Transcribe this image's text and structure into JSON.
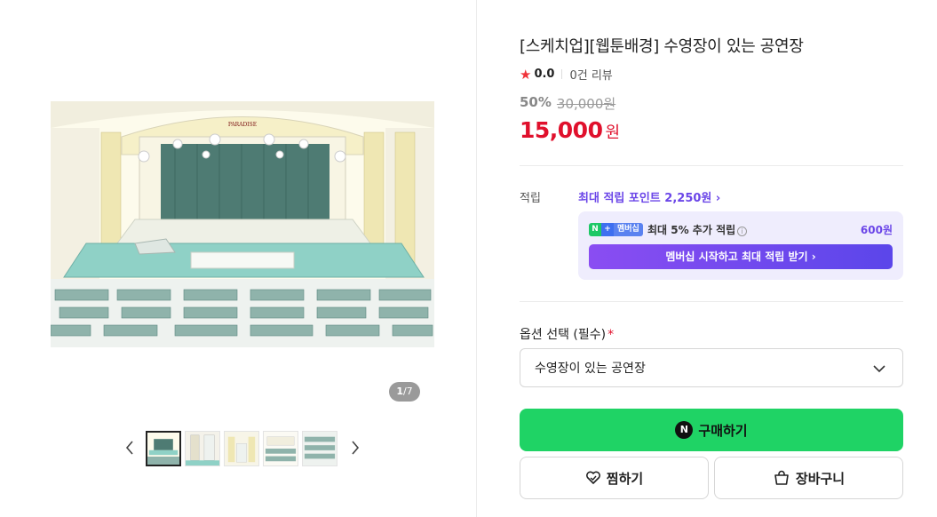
{
  "gallery": {
    "counter_current": "1",
    "counter_total": "/7",
    "prev_label": "previous-arrow",
    "next_label": "next-arrow",
    "thumbnail_count": 5,
    "image_sign_text": "PARADISE"
  },
  "product": {
    "title": "[스케치업][웹툰배경] 수영장이 있는 공연장",
    "rating_icon": "star-icon",
    "rating": "0.0",
    "reviews": "0건 리뷰",
    "discount": "50%",
    "original_price": "30,000원",
    "price": "15,000",
    "currency": "원"
  },
  "points": {
    "label": "적립",
    "max_points_text": "최대 적립 포인트 2,250원 ›",
    "membership_badge_n": "N",
    "membership_badge_plus": "+",
    "membership_badge_text": "멤버십",
    "membership_text": "최대 5% 추가 적립",
    "membership_info_icon": "i",
    "membership_amount": "600원",
    "membership_button": "멤버십 시작하고 최대 적립 받기 ›"
  },
  "options": {
    "label": "옵션 선택 (필수)",
    "required_mark": "*",
    "selected": "수영장이 있는 공연장"
  },
  "actions": {
    "npay_icon_text": "N",
    "buy_label": "구매하기",
    "wishlist_label": "찜하기",
    "cart_label": "장바구니"
  },
  "colors": {
    "price_red": "#e0102c",
    "buy_green": "#1fd365",
    "member_purple": "#6b46e8",
    "member_box_bg": "#efedfd"
  }
}
